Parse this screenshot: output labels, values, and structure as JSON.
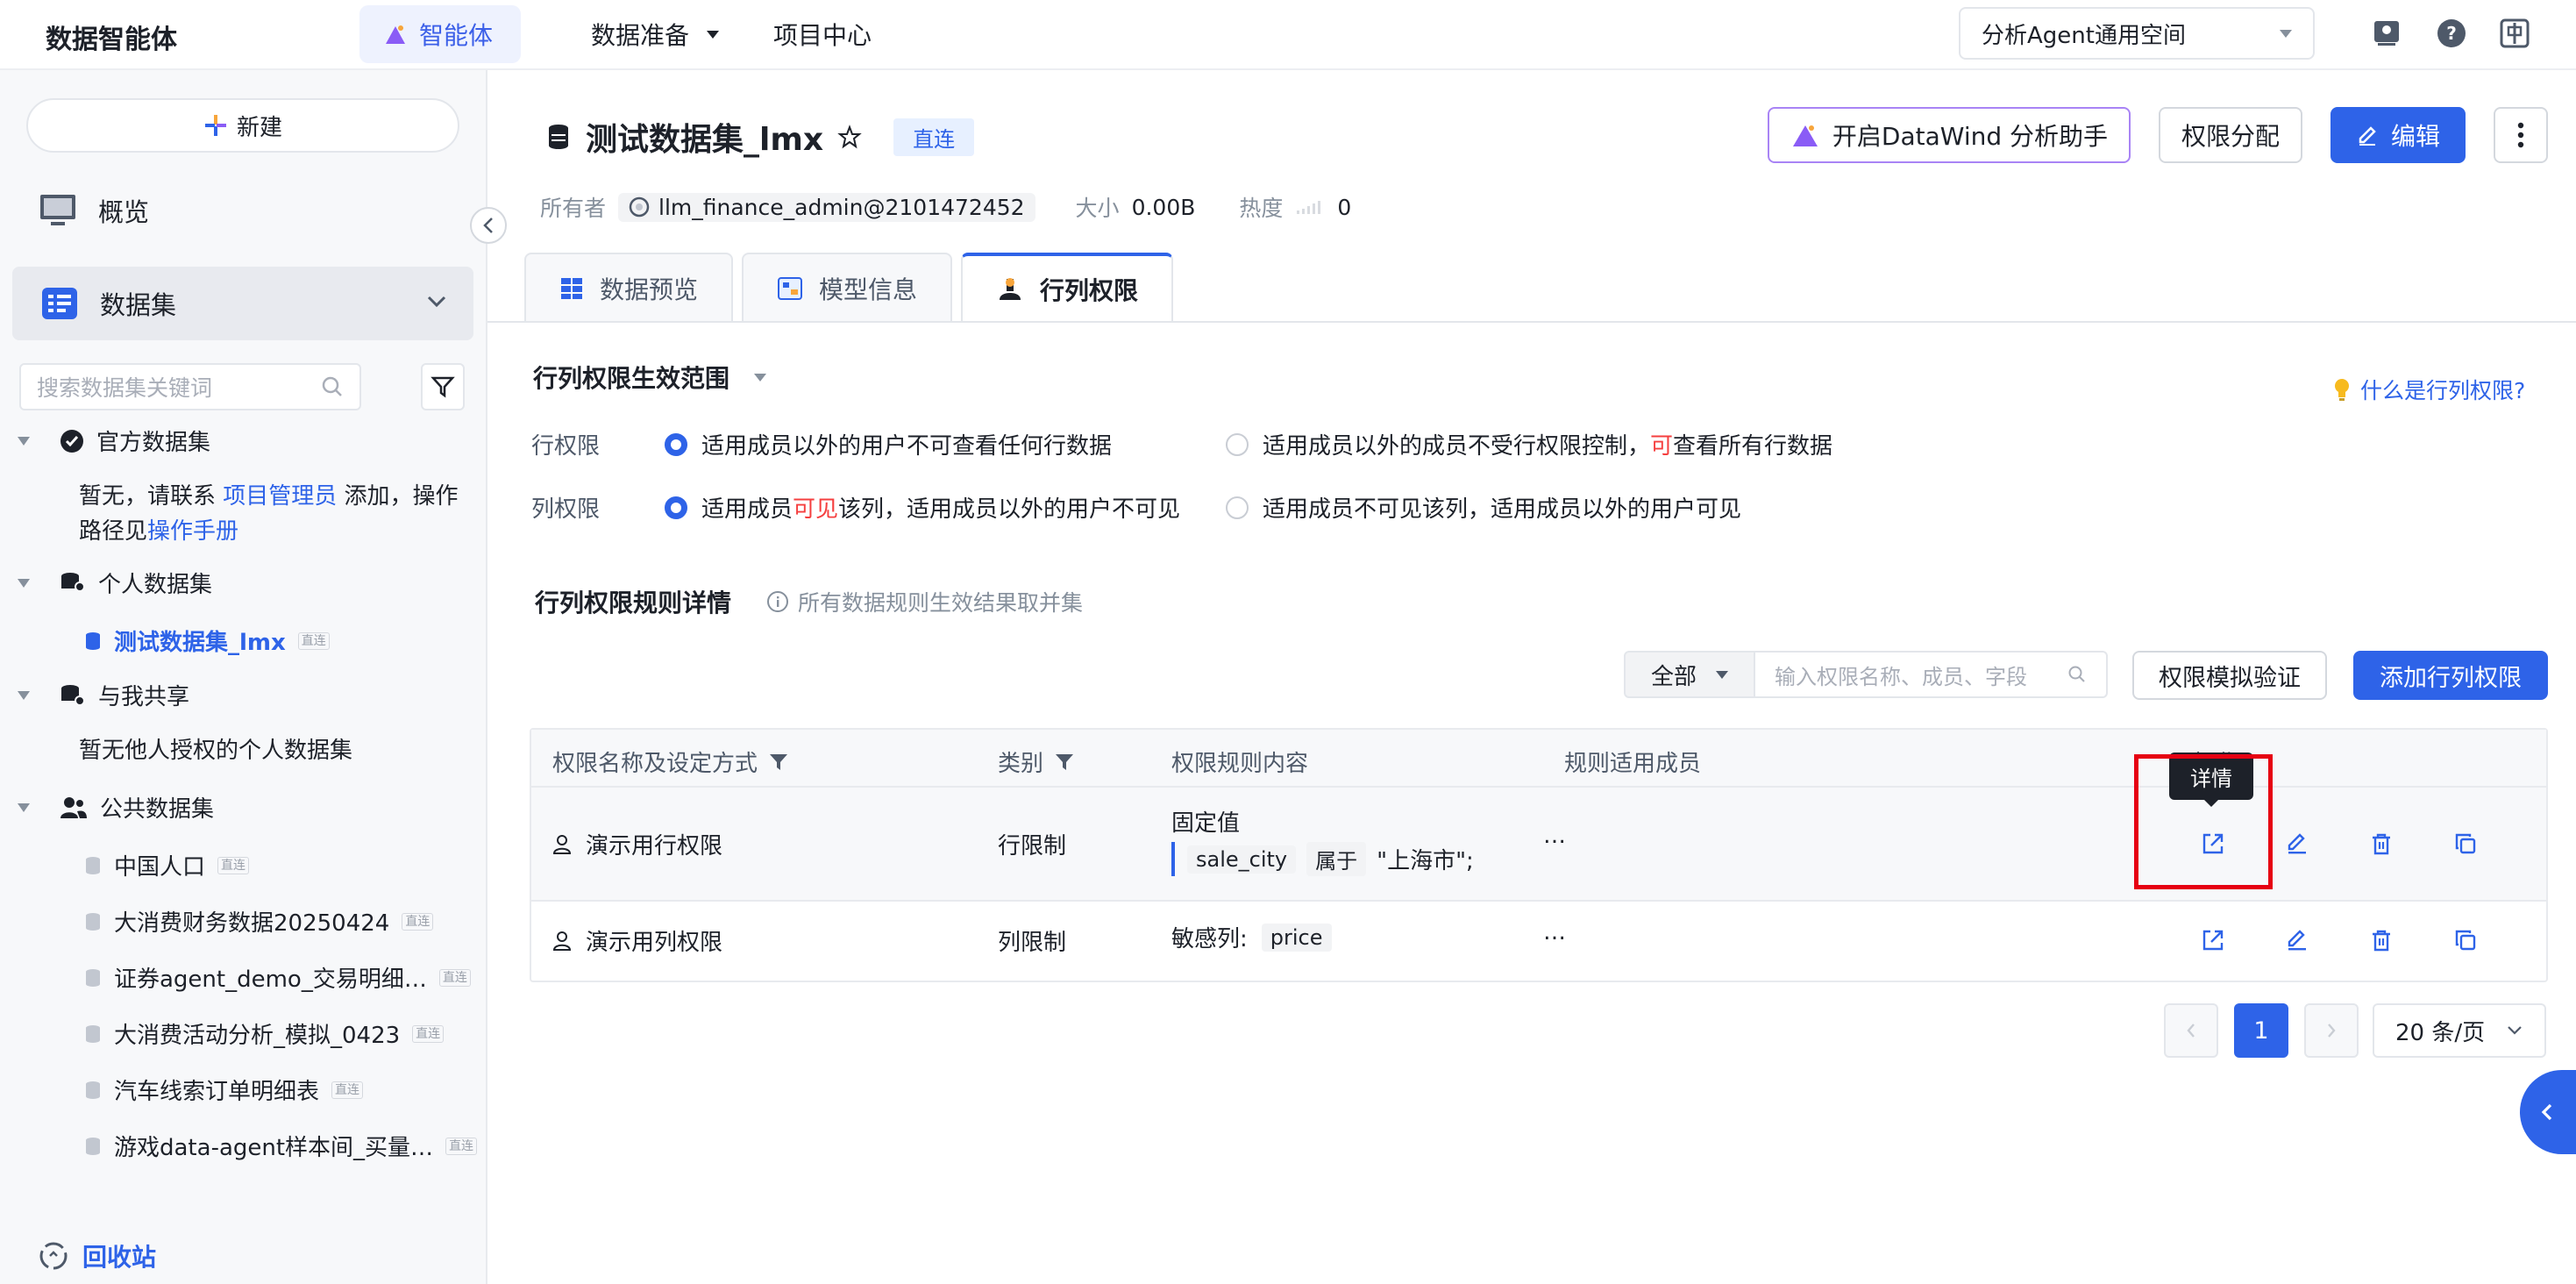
{
  "topnav": {
    "app_title": "数据智能体",
    "tabs": [
      {
        "label": "智能体",
        "active": true
      },
      {
        "label": "数据准备",
        "has_dropdown": true
      },
      {
        "label": "项目中心"
      }
    ],
    "workspace": "分析Agent通用空间",
    "icons": [
      "monitor-icon",
      "help-icon",
      "language-icon"
    ]
  },
  "sidebar": {
    "new_label": "新建",
    "overview_label": "概览",
    "dataset_label": "数据集",
    "search_placeholder": "搜索数据集关键词",
    "groups": {
      "official": {
        "label": "官方数据集",
        "note_prefix": "暂无，请联系 ",
        "note_link1": "项目管理员",
        "note_mid": " 添加，操作路径见",
        "note_link2": "操作手册"
      },
      "personal": {
        "label": "个人数据集",
        "items": [
          {
            "label": "测试数据集_lmx",
            "tag": "直连"
          }
        ]
      },
      "shared": {
        "label": "与我共享",
        "note": "暂无他人授权的个人数据集"
      },
      "public": {
        "label": "公共数据集",
        "items": [
          {
            "label": "中国人口",
            "tag": "直连"
          },
          {
            "label": "大消费财务数据20250424",
            "tag": "直连"
          },
          {
            "label": "证券agent_demo_交易明细…",
            "tag": "直连"
          },
          {
            "label": "大消费活动分析_模拟_0423",
            "tag": "直连"
          },
          {
            "label": "汽车线索订单明细表",
            "tag": "直连"
          },
          {
            "label": "游戏data-agent样本间_买量…",
            "tag": "直连"
          }
        ]
      }
    },
    "recycle_label": "回收站"
  },
  "dataset": {
    "title": "测试数据集_lmx",
    "badge": "直连",
    "owner_label": "所有者",
    "owner": "llm_finance_admin@2101472452",
    "size_label": "大小",
    "size": "0.00B",
    "heat_label": "热度",
    "heat": "0"
  },
  "actions": {
    "datawind": "开启DataWind 分析助手",
    "perm_assign": "权限分配",
    "edit": "编辑"
  },
  "tabs": [
    {
      "label": "数据预览"
    },
    {
      "label": "模型信息"
    },
    {
      "label": "行列权限",
      "active": true
    }
  ],
  "scope": {
    "title": "行列权限生效范围",
    "help": "什么是行列权限?",
    "row_label": "行权限",
    "row_opt1": "适用成员以外的用户不可查看任何行数据",
    "row_opt2_a": "适用成员以外的成员不受行权限控制，",
    "row_opt2_red": "可",
    "row_opt2_b": "查看所有行数据",
    "col_label": "列权限",
    "col_opt1_a": "适用成员",
    "col_opt1_red": "可见",
    "col_opt1_b": "该列，适用成员以外的用户不可见",
    "col_opt2": "适用成员不可见该列，适用成员以外的用户可见"
  },
  "rules": {
    "title": "行列权限规则详情",
    "note": "所有数据规则生效结果取并集",
    "filter_value": "全部",
    "search_placeholder": "输入权限名称、成员、字段",
    "simulate": "权限模拟验证",
    "add": "添加行列权限",
    "columns": [
      "权限名称及设定方式",
      "类别",
      "权限规则内容",
      "规则适用成员",
      "操作"
    ],
    "rows": [
      {
        "name": "演示用行权限",
        "category": "行限制",
        "content_title": "固定值",
        "field": "sale_city",
        "op": "属于",
        "value": "\"上海市\";",
        "members": "…"
      },
      {
        "name": "演示用列权限",
        "category": "列限制",
        "content_label": "敏感列:",
        "field": "price",
        "members": "…"
      }
    ],
    "tooltip": "详情"
  },
  "pagination": {
    "current": "1",
    "page_size": "20 条/页"
  },
  "colors": {
    "primary": "#2e63e8",
    "highlight": "#e60012",
    "danger_text": "#f53f3f"
  }
}
